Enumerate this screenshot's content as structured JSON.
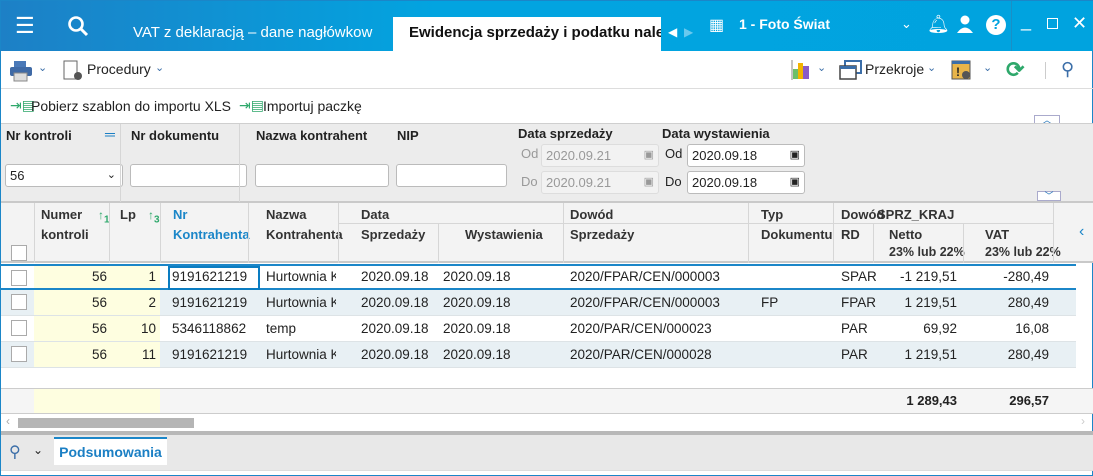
{
  "titlebar": {
    "tabs": [
      {
        "label": "VAT z deklaracją – dane nagłówkowe"
      },
      {
        "label": "Ewidencja sprzedaży i podatku należnego"
      }
    ],
    "company": "1 - Foto Świat"
  },
  "toolbar": {
    "procedures": "Procedury",
    "sections": "Przekroje"
  },
  "actions": {
    "download_template": "Pobierz szablon do importu XLS",
    "import_package": "Importuj paczkę"
  },
  "filters": {
    "nr_kontroli": {
      "label": "Nr kontroli",
      "value": "56"
    },
    "nr_dokumentu": {
      "label": "Nr dokumentu",
      "value": ""
    },
    "nazwa": {
      "label": "Nazwa kontrahent",
      "value": ""
    },
    "nip": {
      "label": "NIP",
      "value": ""
    },
    "data_sprzedazy": {
      "label": "Data sprzedaży",
      "od_label": "Od",
      "do_label": "Do",
      "od": "2020.09.21",
      "do": "2020.09.21"
    },
    "data_wystawienia": {
      "label": "Data wystawienia",
      "od_label": "Od",
      "do_label": "Do",
      "od": "2020.09.18",
      "do": "2020.09.18"
    }
  },
  "grid": {
    "headers": {
      "numer": "Numer",
      "kontroli": "kontroli",
      "sort1": "1",
      "lp": "Lp",
      "sort3": "3",
      "nr": "Nr",
      "kontrahenta": "Kontrahenta",
      "nazwa": "Nazwa",
      "kontrahenta2": "Kontrahenta",
      "data": "Data",
      "sprzedazy": "Sprzedaży",
      "wystawienia": "Wystawienia",
      "dowod": "Dowód",
      "sprzedazy2": "Sprzedaży",
      "typ": "Typ",
      "dokumentu": "Dokumentu",
      "dowod_rd": "Dowód",
      "rd": "RD",
      "group": "SPRZ_KRAJ",
      "netto": "Netto",
      "netto_sub": "23% lub 22%",
      "vat": "VAT",
      "vat_sub": "23% lub 22%"
    },
    "rows": [
      {
        "nr_kontroli": "56",
        "lp": "1",
        "nr_kontrahenta": "9191621219",
        "nazwa": "Hurtownia Kat",
        "data_sprzedazy": "2020.09.18",
        "data_wystawienia": "2020.09.18",
        "dowod": "2020/FPAR/CEN/000003",
        "typ": "",
        "rd": "SPAR",
        "netto": "-1 219,51",
        "vat": "-280,49"
      },
      {
        "nr_kontroli": "56",
        "lp": "2",
        "nr_kontrahenta": "9191621219",
        "nazwa": "Hurtownia Kat",
        "data_sprzedazy": "2020.09.18",
        "data_wystawienia": "2020.09.18",
        "dowod": "2020/FPAR/CEN/000003",
        "typ": "FP",
        "rd": "FPAR",
        "netto": "1 219,51",
        "vat": "280,49"
      },
      {
        "nr_kontroli": "56",
        "lp": "10",
        "nr_kontrahenta": "5346118862",
        "nazwa": "temp",
        "data_sprzedazy": "2020.09.18",
        "data_wystawienia": "2020.09.18",
        "dowod": "2020/PAR/CEN/000023",
        "typ": "",
        "rd": "PAR",
        "netto": "69,92",
        "vat": "16,08"
      },
      {
        "nr_kontroli": "56",
        "lp": "11",
        "nr_kontrahenta": "9191621219",
        "nazwa": "Hurtownia Kat",
        "data_sprzedazy": "2020.09.18",
        "data_wystawienia": "2020.09.18",
        "dowod": "2020/PAR/CEN/000028",
        "typ": "",
        "rd": "PAR",
        "netto": "1 219,51",
        "vat": "280,49"
      }
    ],
    "totals": {
      "netto": "1 289,43",
      "vat": "296,57"
    }
  },
  "bottom": {
    "tab": "Podsumowania"
  },
  "colors": {
    "accent": "#0a7cc1",
    "titlebar": "#00a3df",
    "highlight": "#fefee0"
  }
}
